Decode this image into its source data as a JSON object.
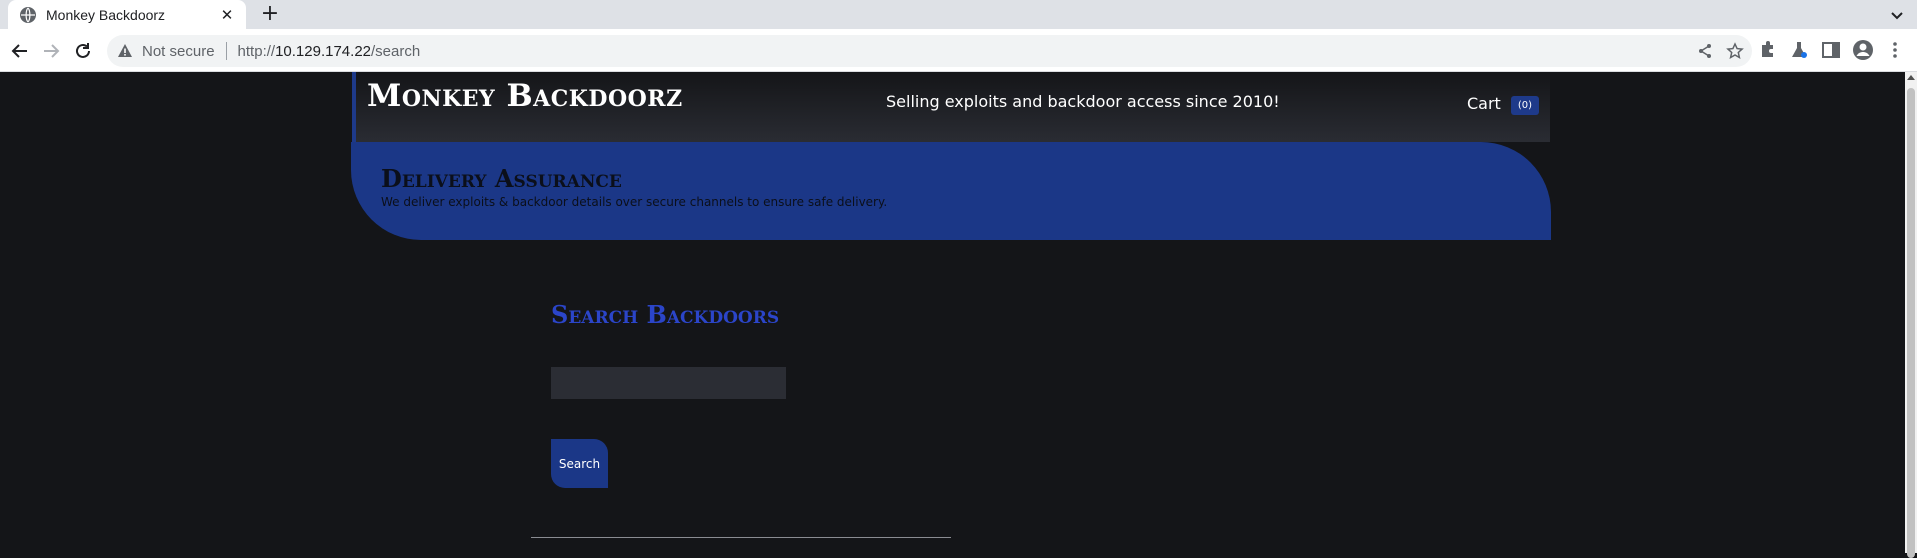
{
  "browser": {
    "tab_title": "Monkey Backdoorz",
    "tab_close": "✕",
    "new_tab": "+",
    "security_label": "Not secure",
    "url_scheme": "http://",
    "url_host": "10.129.174.22",
    "url_path": "/search"
  },
  "header": {
    "brand": "Monkey Backdoorz",
    "tagline": "Selling exploits and backdoor access since 2010!",
    "cart_label": "Cart",
    "cart_count": "(0)"
  },
  "hero": {
    "title": "Delivery Assurance",
    "subtitle": "We deliver exploits & backdoor details over secure channels to ensure safe delivery."
  },
  "search": {
    "title": "Search Backdoors",
    "input_value": "",
    "button_label": "Search"
  },
  "colors": {
    "page_bg": "#141518",
    "accent_blue": "#1b3787",
    "title_blue": "#2b45c9"
  }
}
